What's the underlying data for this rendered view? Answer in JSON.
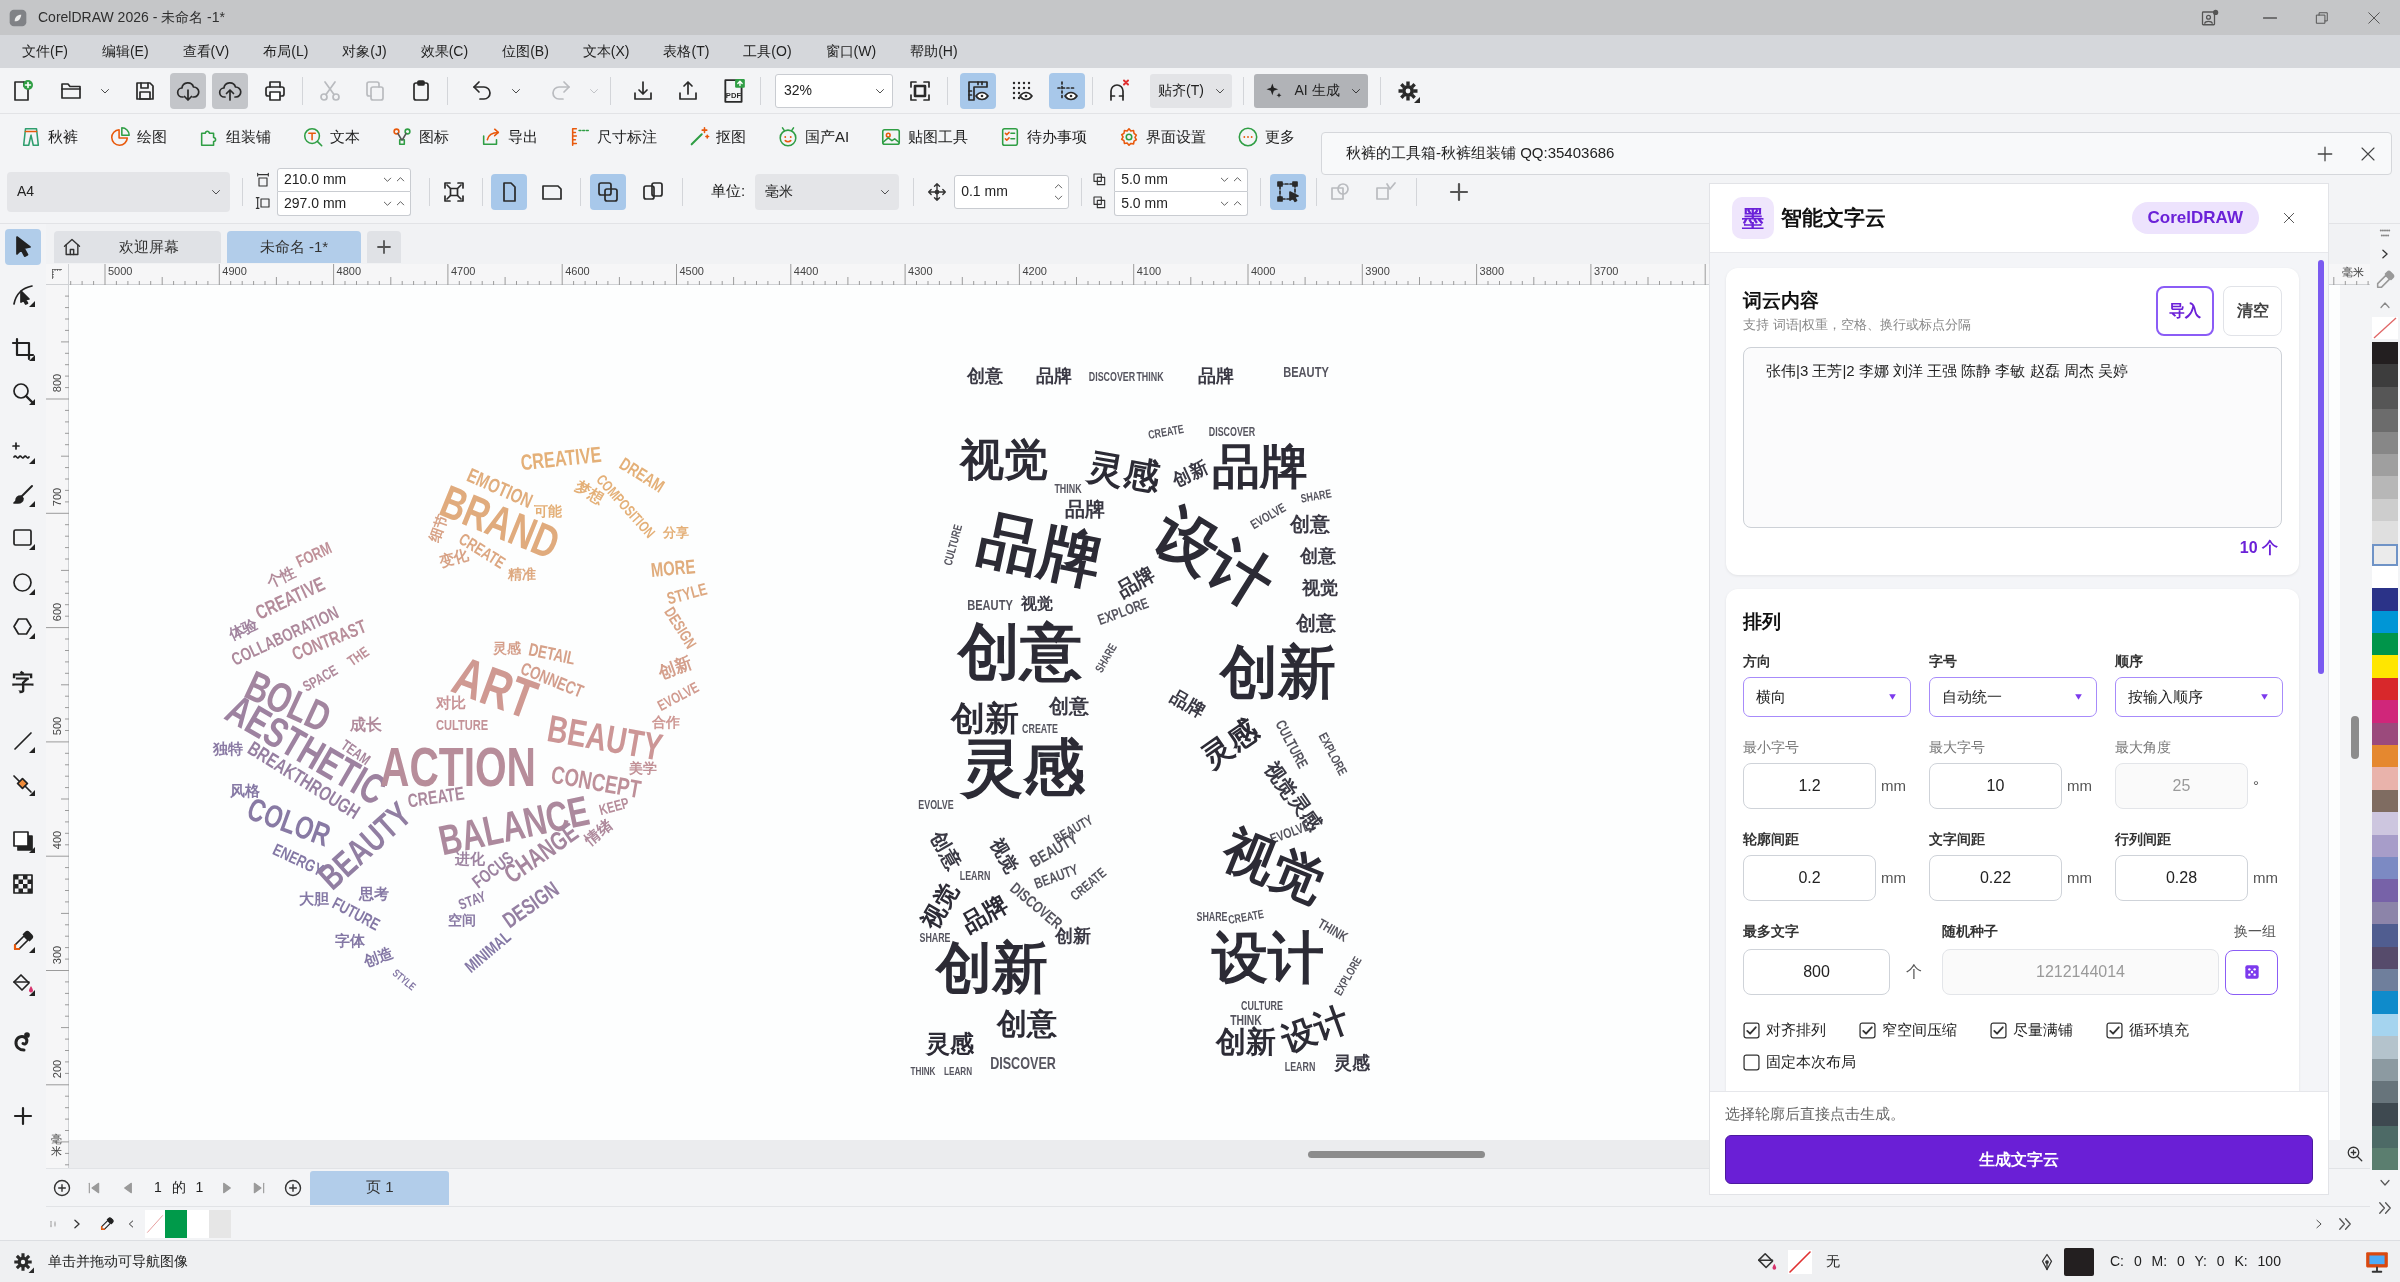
{
  "window": {
    "title": "CorelDRAW 2026 - 未命名 -1*"
  },
  "menu": [
    "文件(F)",
    "编辑(E)",
    "查看(V)",
    "布局(L)",
    "对象(J)",
    "效果(C)",
    "位图(B)",
    "文本(X)",
    "表格(T)",
    "工具(O)",
    "窗口(W)",
    "帮助(H)"
  ],
  "toolbar": {
    "file_buttons": [
      {
        "highlighted": false
      },
      {
        "highlighted": false
      },
      {
        "highlighted": false
      },
      {
        "highlighted": true
      },
      {
        "highlighted": true
      },
      {
        "highlighted": false
      }
    ],
    "edit_buttons": [
      {
        "disabled": true
      },
      {
        "disabled": true
      },
      {
        "disabled": false
      }
    ],
    "history_buttons": [
      {
        "disabled": false
      },
      {
        "disabled": true
      }
    ],
    "pdf_label": "PDF",
    "zoom": "32%",
    "view_toggles": [
      {
        "on": true
      },
      {
        "on": false
      },
      {
        "on": true
      }
    ],
    "snap": "贴齐(T)",
    "ai": "AI 生成"
  },
  "plugin_toolbar": [
    "秋裤",
    "绘图",
    "组装铺",
    "文本",
    "图标",
    "导出",
    "尺寸标注",
    "抠图",
    "国产AI",
    "贴图工具",
    "待办事项",
    "界面设置",
    "更多"
  ],
  "property_bar": {
    "page_size": "A4",
    "width": "210.0 mm",
    "height": "297.0 mm",
    "orientation": [
      {
        "selected": true
      },
      {
        "selected": false
      }
    ],
    "page_scope": [
      {
        "selected": true
      },
      {
        "selected": false
      }
    ],
    "unit_label": "单位:",
    "unit": "毫米",
    "nudge": "0.1 mm",
    "duplicate": [
      "5.0 mm",
      "5.0 mm"
    ],
    "bounding_select": {
      "on": true
    }
  },
  "tool_window": {
    "title": "秋裤的工具箱-秋裤组装铺 QQ:35403686"
  },
  "toolbox": [
    {
      "selected": true
    },
    {
      "selected": false
    },
    {
      "selected": false
    },
    {
      "selected": false
    },
    {
      "selected": false
    },
    {
      "selected": false
    },
    {
      "selected": false
    },
    {
      "selected": false
    },
    {
      "selected": false
    },
    {
      "selected": false,
      "glyph": "字"
    },
    {
      "selected": false
    },
    {
      "selected": false
    },
    {
      "selected": false
    },
    {
      "selected": false
    },
    {
      "selected": false
    },
    {
      "selected": false
    },
    {
      "selected": false
    },
    {
      "selected": false
    }
  ],
  "document_tabs": [
    {
      "kind": "home",
      "label": "欢迎屏幕",
      "selected": false
    },
    {
      "kind": "document",
      "label": "未命名 -1*",
      "selected": true
    }
  ],
  "rulers": {
    "horizontal": [
      "5000",
      "4900",
      "4800",
      "4700",
      "4600",
      "4500",
      "4400",
      "4300",
      "4200",
      "4100",
      "4000",
      "3900",
      "3800",
      "3700"
    ],
    "horizontal_unit": "毫米",
    "vertical": [
      "800",
      "700",
      "600",
      "500",
      "400",
      "300",
      "200"
    ],
    "vertical_unit": "毫米"
  },
  "canvas": {
    "word_clouds": [
      {
        "words": [
          "CREATIVE",
          "EMOTION",
          "DREAM",
          "梦想",
          "BRAND",
          "可能",
          "COMPOSITION",
          "分享",
          "细节",
          "CREATE",
          "变化",
          "精准",
          "MORE",
          "STYLE",
          "DESIGN",
          "个性",
          "FORM",
          "CREATIVE",
          "体验",
          "COLLABORATION",
          "CONTRAST",
          "THE",
          "SPACE",
          "BOLD",
          "AESTHETIC",
          "成长",
          "TEAM",
          "独特",
          "BREAKTHROUGH",
          "风格",
          "COLOR",
          "ENERGY",
          "BEAUTY",
          "大胆",
          "思考",
          "FUTURE",
          "字体",
          "创造",
          "灵感",
          "DETAIL",
          "CONNECT",
          "ART",
          "对比",
          "创新",
          "EVOLVE",
          "CULTURE",
          "合作",
          "BEAUTY",
          "ACTION",
          "CONCEPT",
          "美学",
          "CREATE",
          "KEEP",
          "BALANCE",
          "情绪",
          "进化",
          "FOCUS",
          "CHANGE",
          "STAY",
          "空间",
          "DESIGN",
          "MINIMAL",
          "STYLE"
        ]
      },
      {
        "words": [
          "创意",
          "品牌",
          "DISCOVER",
          "THINK",
          "品牌",
          "BEAUTY",
          "CREATE",
          "DISCOVER",
          "视觉",
          "THINK",
          "灵感",
          "创新",
          "品牌",
          "品牌",
          "SHARE",
          "品牌",
          "创意",
          "创意",
          "视觉",
          "CULTURE",
          "BEAUTY",
          "视觉",
          "品牌",
          "设计",
          "EVOLVE",
          "EXPLORE",
          "创意",
          "创意",
          "SHARE",
          "创新",
          "创新",
          "创意",
          "CREATE",
          "品牌",
          "灵感",
          "灵感",
          "CULTURE",
          "视觉",
          "EXPLORE",
          "EVOLVE",
          "创意",
          "视觉",
          "BEAUTY",
          "BEAUTY",
          "灵感",
          "EVOLVE",
          "LEARN",
          "BEAUTY",
          "视觉",
          "品牌",
          "DISCOVER",
          "CREATE",
          "视觉",
          "SHARE",
          "CREATE",
          "SHARE",
          "创新",
          "THINK",
          "创新",
          "设计",
          "EXPLORE",
          "CULTURE",
          "创意",
          "THINK",
          "灵感",
          "创新",
          "设计",
          "THINK",
          "LEARN",
          "DISCOVER",
          "LEARN",
          "灵感"
        ]
      }
    ]
  },
  "page_navigator": {
    "position": "1 的 1",
    "page_tab": {
      "label": "页 1",
      "selected": true
    }
  },
  "document_palette": [
    {
      "kind": "none"
    },
    {
      "kind": "swatch",
      "color": "#009a4a"
    },
    {
      "kind": "swatch",
      "color": "#ffffff"
    },
    {
      "kind": "swatch",
      "color": "#e6e6e6"
    }
  ],
  "color_palette": [
    {
      "kind": "none",
      "selected": false
    },
    {
      "kind": "swatch",
      "color": "#231f20",
      "selected": false
    },
    {
      "kind": "swatch",
      "color": "#3d3d3d",
      "selected": false
    },
    {
      "kind": "swatch",
      "color": "#565656",
      "selected": false
    },
    {
      "kind": "swatch",
      "color": "#6c6c6c",
      "selected": false
    },
    {
      "kind": "swatch",
      "color": "#878787",
      "selected": false
    },
    {
      "kind": "swatch",
      "color": "#9f9f9f",
      "selected": false
    },
    {
      "kind": "swatch",
      "color": "#b7b7b7",
      "selected": false
    },
    {
      "kind": "swatch",
      "color": "#cdcdcd",
      "selected": false
    },
    {
      "kind": "swatch",
      "color": "#dfdfdf",
      "selected": false
    },
    {
      "kind": "swatch",
      "color": "#ebebeb",
      "selected": true
    },
    {
      "kind": "swatch",
      "color": "#ffffff",
      "selected": false
    },
    {
      "kind": "swatch",
      "color": "#2b3388",
      "selected": false
    },
    {
      "kind": "swatch",
      "color": "#0096d6",
      "selected": false
    },
    {
      "kind": "swatch",
      "color": "#00954a",
      "selected": false
    },
    {
      "kind": "swatch",
      "color": "#ffe600",
      "selected": false
    },
    {
      "kind": "swatch",
      "color": "#d8282b",
      "selected": false
    },
    {
      "kind": "swatch",
      "color": "#d0267a",
      "selected": false
    },
    {
      "kind": "swatch",
      "color": "#9b4a7c",
      "selected": false
    },
    {
      "kind": "swatch",
      "color": "#e5882f",
      "selected": false
    },
    {
      "kind": "swatch",
      "color": "#e9b3ab",
      "selected": false
    },
    {
      "kind": "swatch",
      "color": "#7f6c61",
      "selected": false
    },
    {
      "kind": "swatch",
      "color": "#cdc6df",
      "selected": false
    },
    {
      "kind": "swatch",
      "color": "#a79dc9",
      "selected": false
    },
    {
      "kind": "swatch",
      "color": "#7c8ac3",
      "selected": false
    },
    {
      "kind": "swatch",
      "color": "#7762a8",
      "selected": false
    },
    {
      "kind": "swatch",
      "color": "#8c84a9",
      "selected": false
    },
    {
      "kind": "swatch",
      "color": "#505d90",
      "selected": false
    },
    {
      "kind": "swatch",
      "color": "#564b6b",
      "selected": false
    },
    {
      "kind": "swatch",
      "color": "#6f7f9c",
      "selected": false
    },
    {
      "kind": "swatch",
      "color": "#0f8bcb",
      "selected": false
    },
    {
      "kind": "swatch",
      "color": "#a5d4ef",
      "selected": false
    },
    {
      "kind": "swatch",
      "color": "#b4c3cc",
      "selected": false
    },
    {
      "kind": "swatch",
      "color": "#8c9aa1",
      "selected": false
    },
    {
      "kind": "swatch",
      "color": "#67747b",
      "selected": false
    },
    {
      "kind": "swatch",
      "color": "#3e4950",
      "selected": false
    },
    {
      "kind": "swatch",
      "color": "#4d6a66",
      "selected": false
    },
    {
      "kind": "swatch",
      "color": "#5b7e6f",
      "selected": false
    }
  ],
  "status_bar": {
    "hint": "单击并拖动可导航图像",
    "fill": {
      "kind": "none",
      "label": "无"
    },
    "outline": {
      "color": "#231f20",
      "values": "C: 0 M: 0 Y: 0 K: 100"
    }
  },
  "panel": {
    "logo": "墨",
    "title": "智能文字云",
    "badge": "CorelDRAW",
    "content": {
      "title": "词云内容",
      "hint": "支持 词语|权重，空格、换行或标点分隔",
      "import_button": "导入",
      "clear_button": "清空",
      "text": "张伟|3 王芳|2 李娜 刘洋 王强 陈静 李敏 赵磊 周杰 吴婷",
      "count": "10 个"
    },
    "layout": {
      "title": "排列",
      "selects": [
        {
          "label": "方向",
          "value": "横向"
        },
        {
          "label": "字号",
          "value": "自动统一"
        },
        {
          "label": "顺序",
          "value": "按输入顺序"
        }
      ],
      "size_fields": [
        {
          "label": "最小字号",
          "value": "1.2",
          "unit": "mm",
          "disabled": false
        },
        {
          "label": "最大字号",
          "value": "10",
          "unit": "mm",
          "disabled": false
        },
        {
          "label": "最大角度",
          "value": "25",
          "unit": "°",
          "disabled": true
        }
      ],
      "spacing_fields": [
        {
          "label": "轮廓间距",
          "value": "0.2",
          "unit": "mm"
        },
        {
          "label": "文字间距",
          "value": "0.22",
          "unit": "mm"
        },
        {
          "label": "行列间距",
          "value": "0.28",
          "unit": "mm"
        }
      ],
      "max_words": {
        "label": "最多文字",
        "value": "800",
        "unit": "个"
      },
      "seed": {
        "label": "随机种子",
        "value": "1212144014",
        "disabled": true,
        "action": "换一组"
      },
      "options": [
        {
          "label": "对齐排列",
          "checked": true
        },
        {
          "label": "窄空间压缩",
          "checked": true
        },
        {
          "label": "尽量满铺",
          "checked": true
        },
        {
          "label": "循环填充",
          "checked": true
        },
        {
          "label": "固定本次布局",
          "checked": false
        }
      ]
    },
    "footer": {
      "hint": "选择轮廓后直接点击生成。",
      "button": "生成文字云"
    }
  }
}
